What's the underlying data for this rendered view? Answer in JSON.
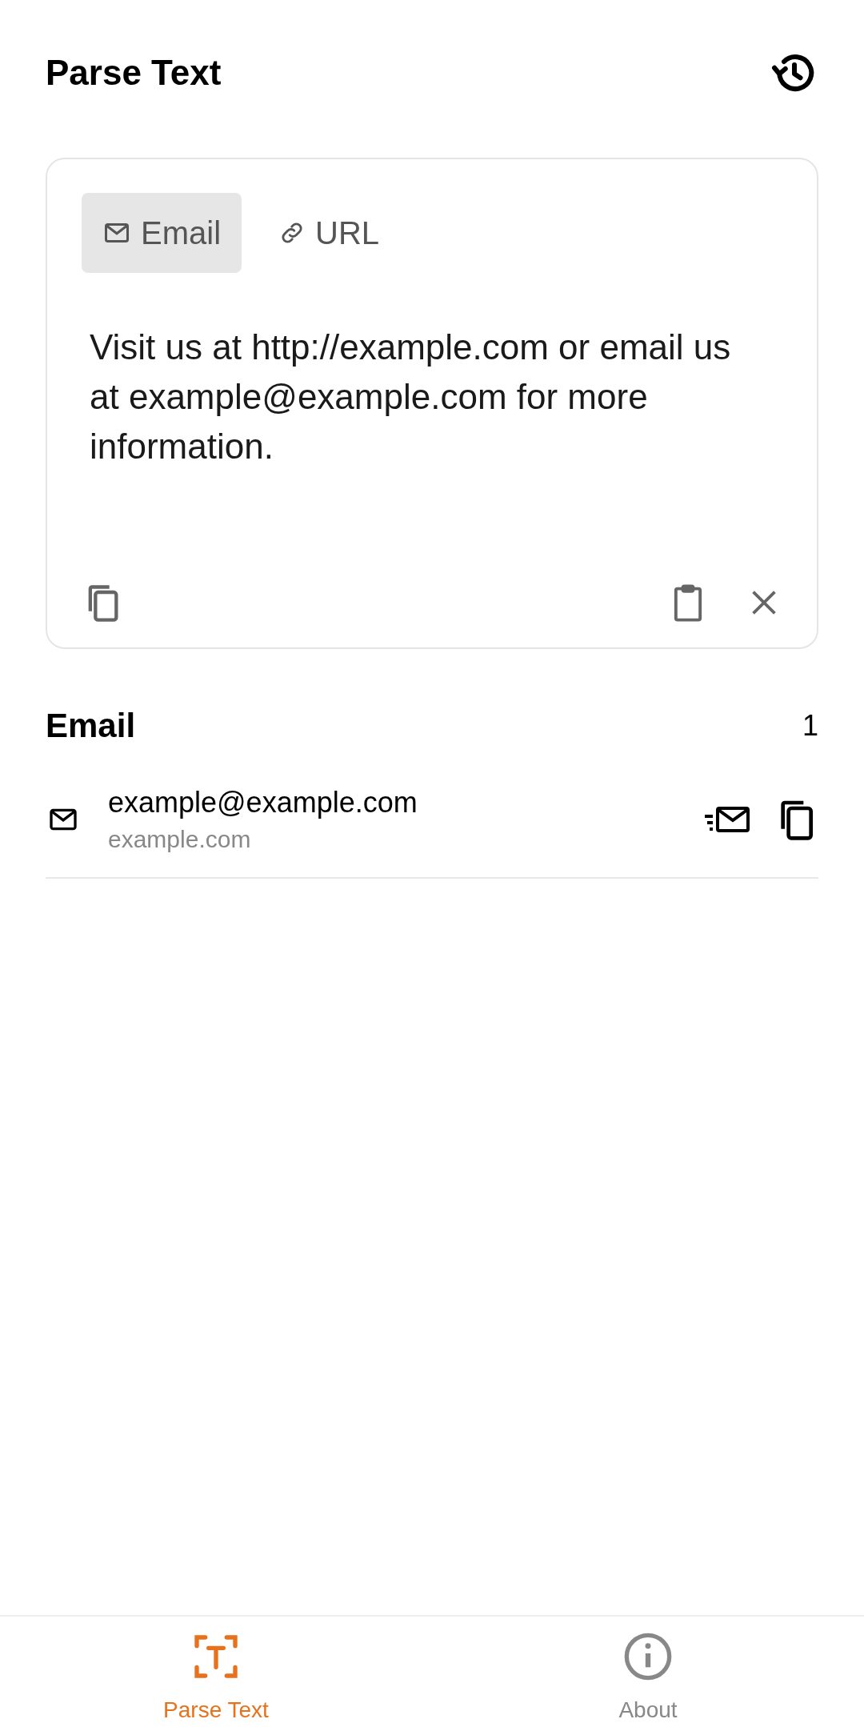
{
  "app_bar": {
    "title": "Parse Text"
  },
  "input_card": {
    "tabs": [
      {
        "kind": "email",
        "label": "Email",
        "selected": true
      },
      {
        "kind": "url",
        "label": "URL",
        "selected": false
      }
    ],
    "text": "Visit us at http://example.com or email us at example@example.com for more information."
  },
  "results": {
    "title": "Email",
    "count": "1",
    "items": [
      {
        "value": "example@example.com",
        "domain": "example.com"
      }
    ]
  },
  "bottom_nav": [
    {
      "kind": "parse",
      "label": "Parse Text",
      "selected": true
    },
    {
      "kind": "about",
      "label": "About",
      "selected": false
    }
  ]
}
